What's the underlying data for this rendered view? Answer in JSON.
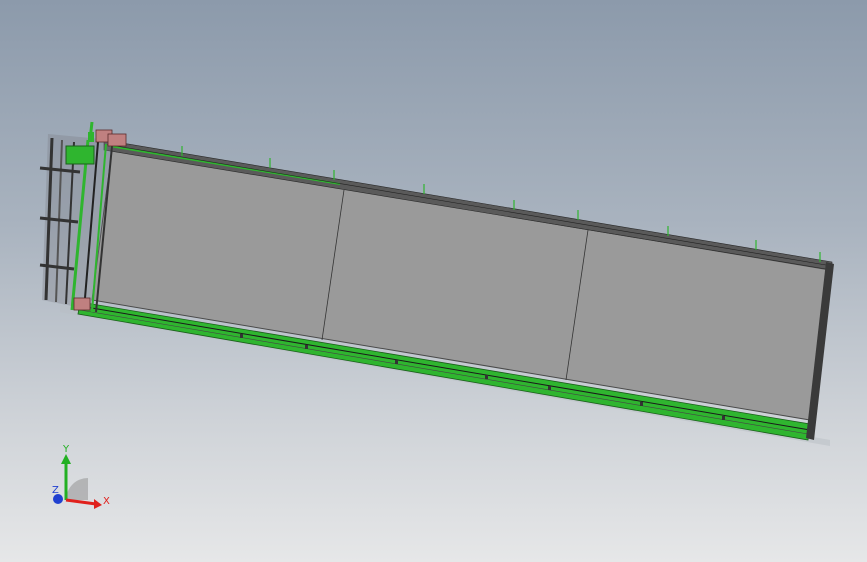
{
  "triad": {
    "x_label": "X",
    "y_label": "Y",
    "z_label": "Z"
  },
  "colors": {
    "background_top": "#8c9aab",
    "background_bottom": "#e6e7e8",
    "panel_fill": "#9a9a9a",
    "frame_green": "#2fb52f",
    "frame_dark": "#3a3a3a",
    "x_axis": "#e0201c",
    "y_axis": "#22b022",
    "z_axis": "#2040d0"
  }
}
